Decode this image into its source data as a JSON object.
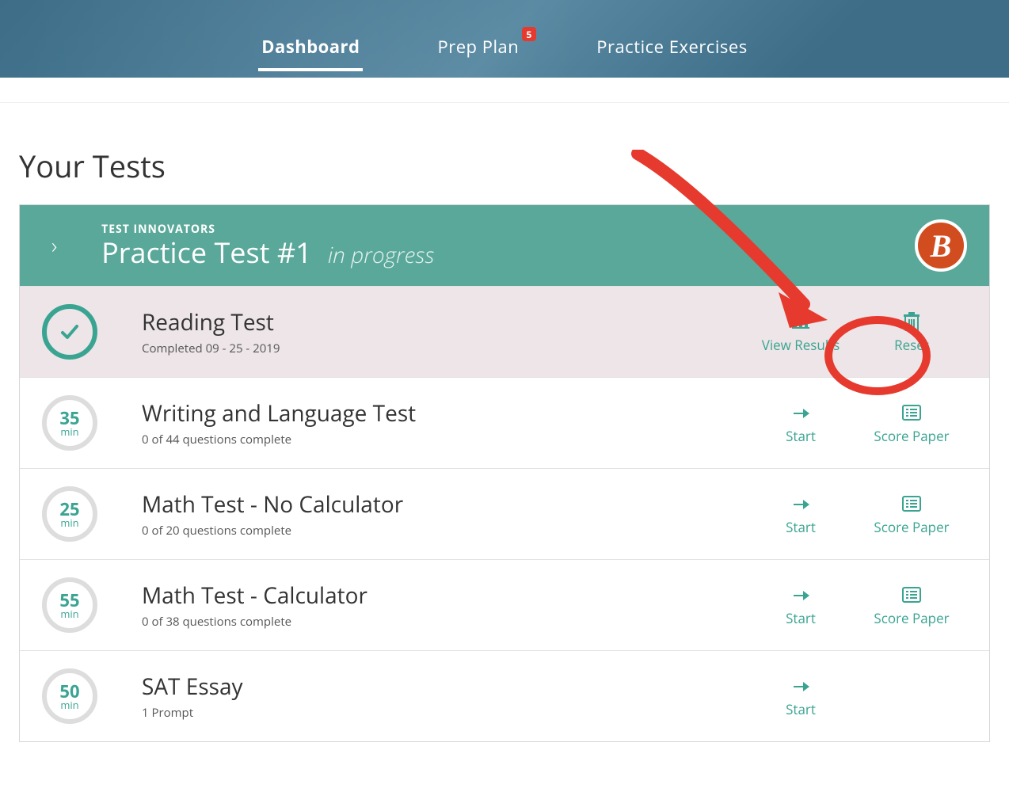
{
  "nav": {
    "tabs": [
      {
        "label": "Dashboard",
        "active": true
      },
      {
        "label": "Prep Plan",
        "badge": "5"
      },
      {
        "label": "Practice Exercises"
      }
    ]
  },
  "page": {
    "title": "Your Tests"
  },
  "test": {
    "brand": "TEST INNOVATORS",
    "title": "Practice Test #1",
    "status": "in progress",
    "badge_letter": "B"
  },
  "sections": [
    {
      "status": "done",
      "title": "Reading Test",
      "subtitle": "Completed 09 - 25 - 2019",
      "actions": [
        {
          "icon": "bar-chart",
          "label": "View Results"
        },
        {
          "icon": "trash",
          "label": "Reset"
        }
      ]
    },
    {
      "minutes": "35",
      "min_label": "min",
      "title": "Writing and Language Test",
      "subtitle": "0 of 44 questions complete",
      "actions": [
        {
          "icon": "arrow-right",
          "label": "Start"
        },
        {
          "icon": "paper",
          "label": "Score Paper"
        }
      ]
    },
    {
      "minutes": "25",
      "min_label": "min",
      "title": "Math Test - No Calculator",
      "subtitle": "0 of 20 questions complete",
      "actions": [
        {
          "icon": "arrow-right",
          "label": "Start"
        },
        {
          "icon": "paper",
          "label": "Score Paper"
        }
      ]
    },
    {
      "minutes": "55",
      "min_label": "min",
      "title": "Math Test - Calculator",
      "subtitle": "0 of 38 questions complete",
      "actions": [
        {
          "icon": "arrow-right",
          "label": "Start"
        },
        {
          "icon": "paper",
          "label": "Score Paper"
        }
      ]
    },
    {
      "minutes": "50",
      "min_label": "min",
      "title": "SAT Essay",
      "subtitle": "1 Prompt",
      "actions": [
        {
          "icon": "arrow-right",
          "label": "Start"
        }
      ]
    }
  ]
}
